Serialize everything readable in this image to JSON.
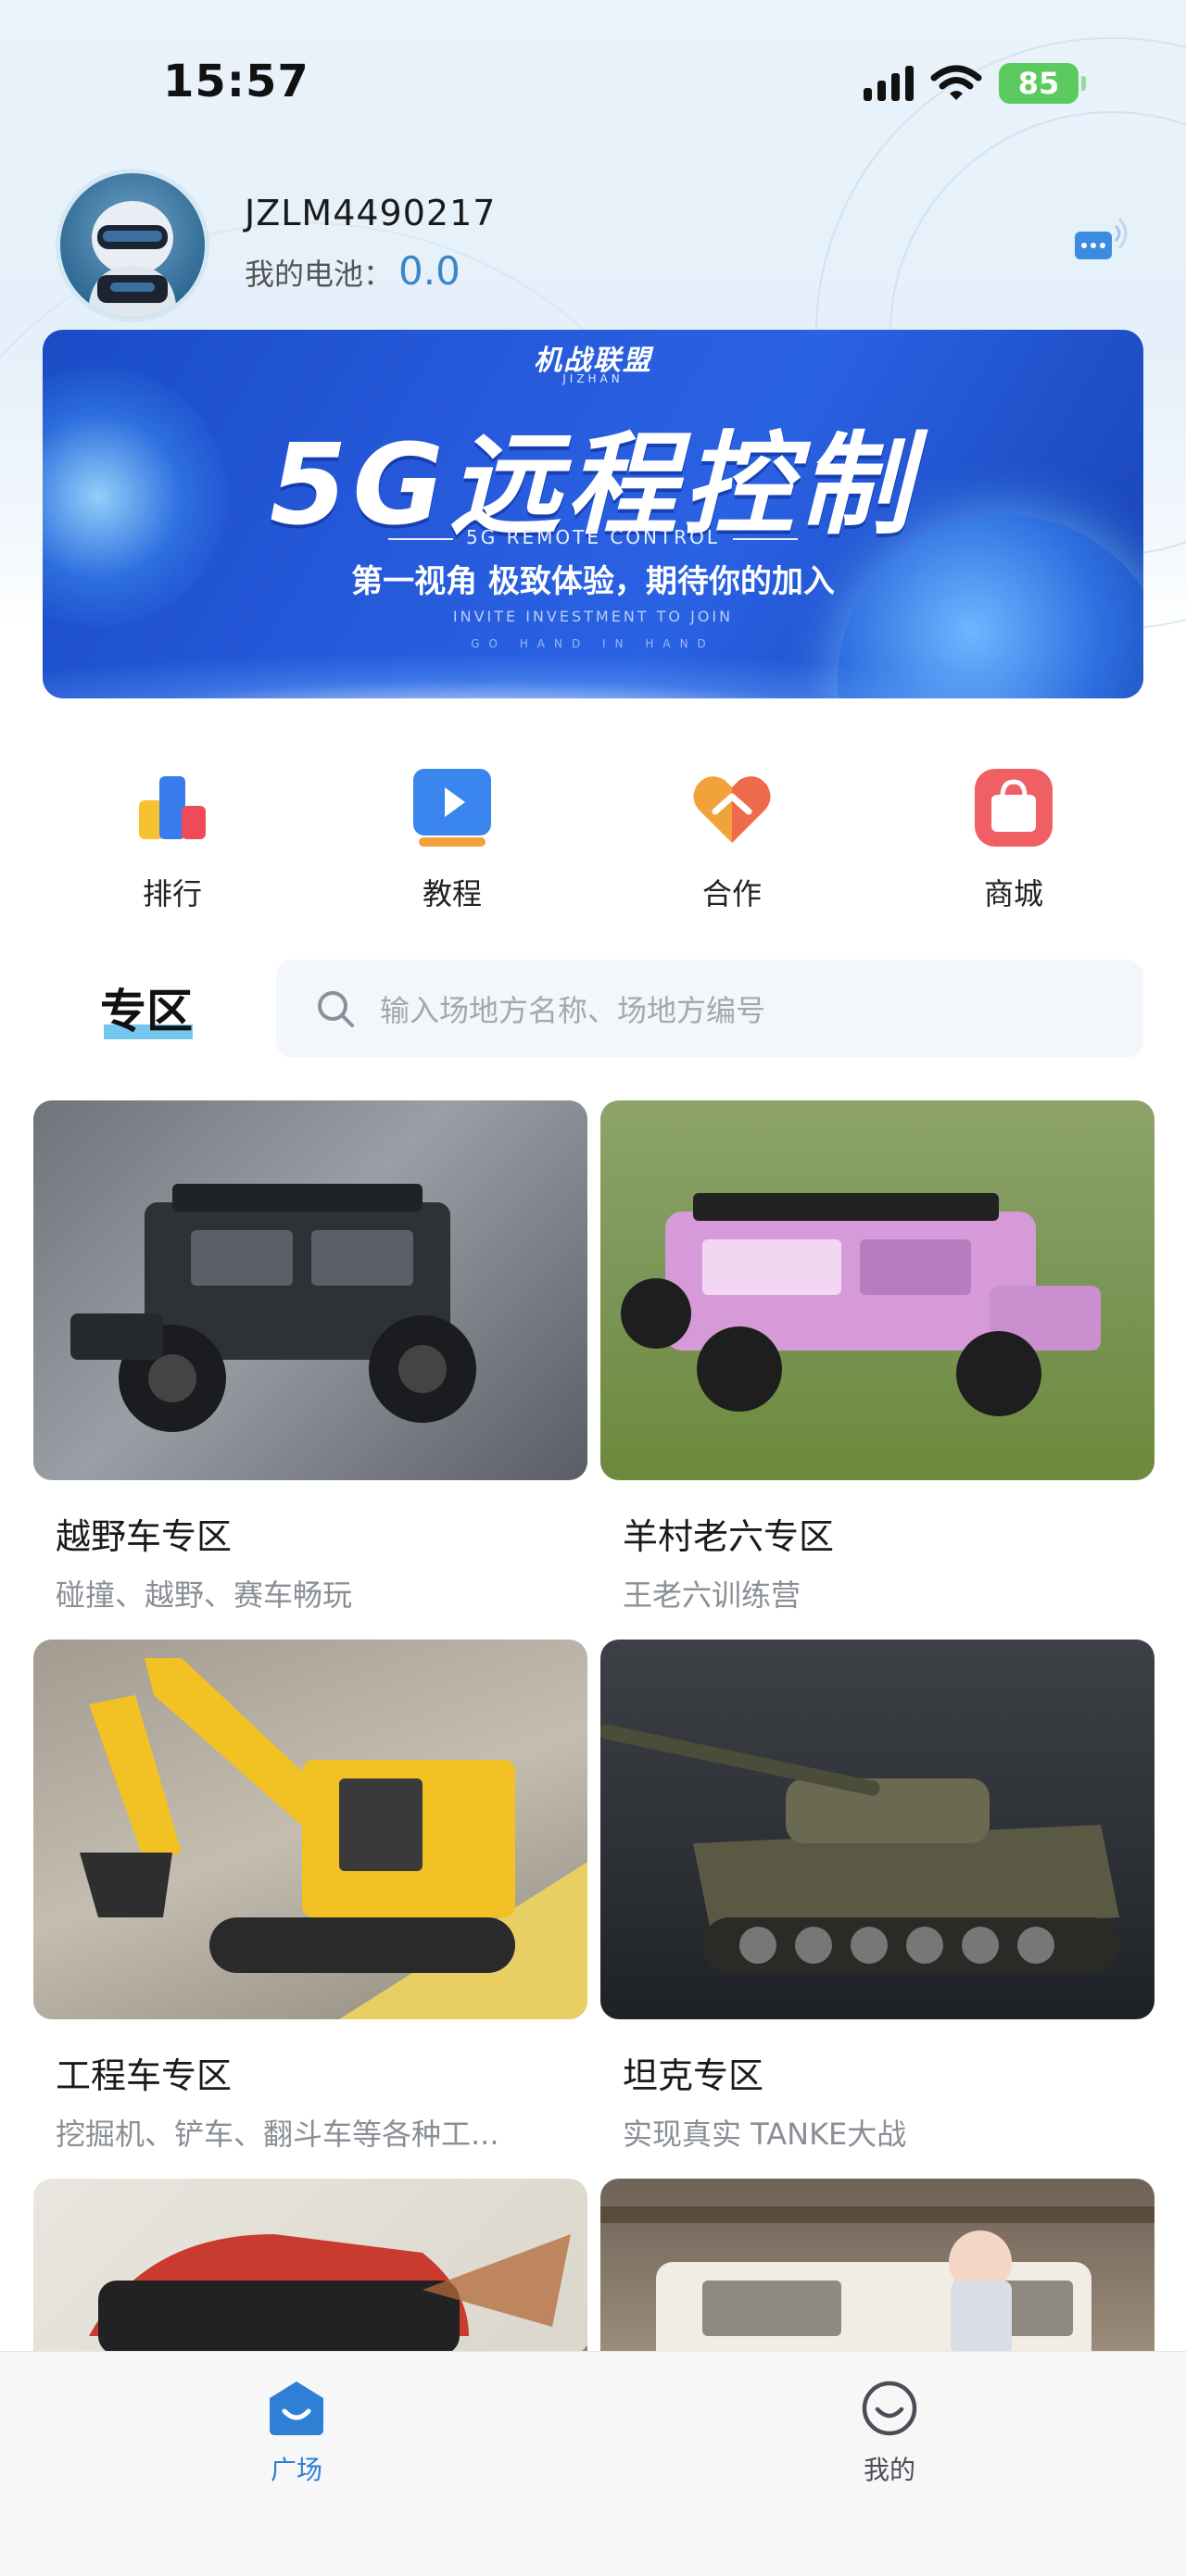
{
  "status_bar": {
    "time": "15:57",
    "battery": "85"
  },
  "profile": {
    "username": "JZLM4490217",
    "battery_label": "我的电池：",
    "battery_value": "0.0"
  },
  "banner": {
    "logo": "机战联盟",
    "logo_sub": "JIZHAN",
    "headline": "5G远程控制",
    "sub_en": "5G REMOTE CONTROL",
    "sub_cn": "第一视角 极致体验，期待你的加入",
    "invite": "INVITE INVESTMENT TO JOIN",
    "hand": "GO HAND IN HAND"
  },
  "quick_nav": [
    {
      "label": "排行",
      "icon": "ranking-bars-icon"
    },
    {
      "label": "教程",
      "icon": "video-play-icon"
    },
    {
      "label": "合作",
      "icon": "handshake-heart-icon"
    },
    {
      "label": "商城",
      "icon": "shopping-bag-icon"
    }
  ],
  "section": {
    "title": "专区",
    "search_placeholder": "输入场地方名称、场地方编号"
  },
  "zones": [
    {
      "title": "越野车专区",
      "desc": "碰撞、越野、赛车畅玩",
      "image": "off-road-rc-truck"
    },
    {
      "title": "羊村老六专区",
      "desc": "王老六训练营",
      "image": "pink-rc-jeep-on-grass"
    },
    {
      "title": "工程车专区",
      "desc": "挖掘机、铲车、翻斗车等各种工...",
      "image": "yellow-rc-excavator"
    },
    {
      "title": "坦克专区",
      "desc": "实现真实 TANKE大战",
      "image": "rc-battle-tank"
    },
    {
      "title": "",
      "desc": "",
      "image": "rally-rc-car"
    },
    {
      "title": "",
      "desc": "",
      "image": "white-suv-garage"
    }
  ],
  "tabbar": [
    {
      "label": "广场",
      "active": true,
      "icon": "home-smile-icon"
    },
    {
      "label": "我的",
      "active": false,
      "icon": "profile-smile-icon"
    }
  ],
  "colors": {
    "accent": "#2f7fd6",
    "tab_active": "#2f7fd6",
    "tab_inactive": "#4a4f57",
    "section_underline": "#74c8ef"
  }
}
